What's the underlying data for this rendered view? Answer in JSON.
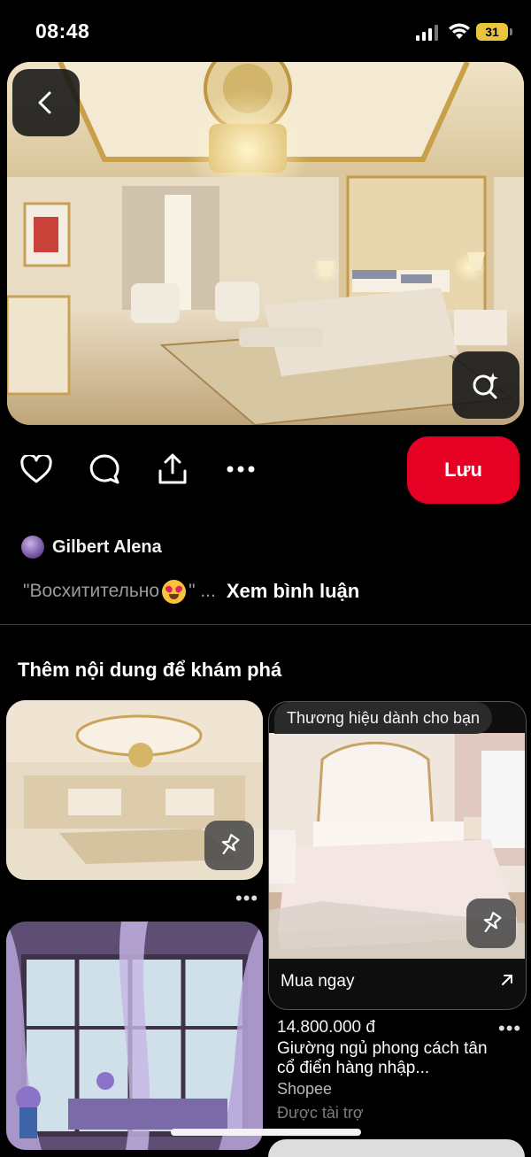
{
  "status_bar": {
    "time": "08:48",
    "battery": "31"
  },
  "pin": {
    "actions": {
      "save_label": "Lưu"
    },
    "author": {
      "name": "Gilbert Alena"
    },
    "comment": {
      "text_before": "\"Восхитительно ",
      "text_after": "\" ...",
      "see_comments": "Xem bình luận"
    }
  },
  "explore": {
    "title": "Thêm nội dung để khám phá",
    "brand_card": {
      "badge": "Thương hiệu dành cho bạn",
      "cta": "Mua ngay",
      "price": "14.800.000 đ",
      "title_line1": "Giường ngủ phong cách tân",
      "title_line2": "cổ điển hàng nhập...",
      "shop": "Shopee",
      "sponsored": "Được tài trợ"
    },
    "more_dots": "•••"
  },
  "icons": [
    "back-arrow-icon",
    "visual-search-icon",
    "heart-icon",
    "comment-icon",
    "share-icon",
    "more-icon",
    "pin-icon",
    "external-link-icon",
    "signal-icon",
    "wifi-icon",
    "battery-icon"
  ],
  "colors": {
    "save_button": "#e60023",
    "background": "#000000"
  }
}
